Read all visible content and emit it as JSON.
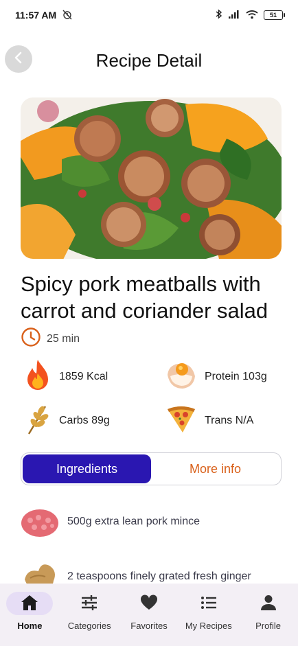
{
  "status_bar": {
    "time": "11:57 AM",
    "battery": "51"
  },
  "header": {
    "title": "Recipe Detail",
    "back_icon": "chevron-left-icon"
  },
  "recipe": {
    "title": "Spicy pork meatballs with carrot and coriander salad",
    "time": "25 min",
    "nutrition": [
      {
        "icon": "fire-icon",
        "label": "1859 Kcal"
      },
      {
        "icon": "egg-icon",
        "label": "Protein 103g"
      },
      {
        "icon": "wheat-icon",
        "label": "Carbs 89g"
      },
      {
        "icon": "pizza-icon",
        "label": "Trans N/A"
      }
    ]
  },
  "tabs": {
    "ingredients": "Ingredients",
    "more_info": "More info",
    "active": "Ingredients"
  },
  "ingredients": [
    {
      "text": "500g extra lean pork mince"
    },
    {
      "text": "2 teaspoons finely grated fresh ginger"
    }
  ],
  "bottom_nav": {
    "active": "Home",
    "items": [
      {
        "label": "Home",
        "icon": "home-icon"
      },
      {
        "label": "Categories",
        "icon": "sliders-icon"
      },
      {
        "label": "Favorites",
        "icon": "heart-icon"
      },
      {
        "label": "My Recipes",
        "icon": "list-icon"
      },
      {
        "label": "Profile",
        "icon": "person-icon"
      }
    ]
  },
  "colors": {
    "accent": "#2A17B1",
    "inactive_tab_text": "#D9601A",
    "nav_background": "#F3EFF5",
    "time_icon": "#D9601A"
  }
}
